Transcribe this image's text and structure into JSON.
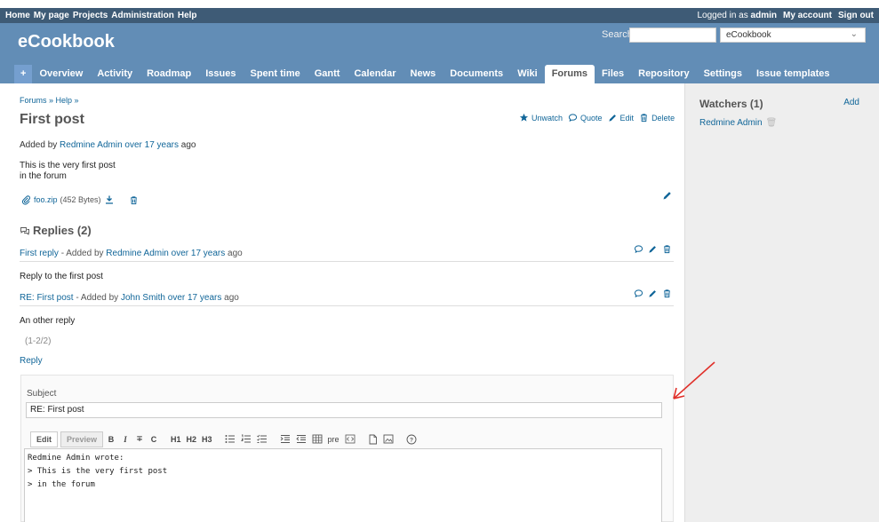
{
  "top_menu": {
    "left_items": [
      "Home",
      "My page",
      "Projects",
      "Administration",
      "Help"
    ],
    "logged_prefix": "Logged in as",
    "logged_user": "admin",
    "right_items": [
      "My account",
      "Sign out"
    ]
  },
  "header": {
    "title": "eCookbook",
    "search_label": "Search:",
    "search_value": "",
    "project_selected": "eCookbook"
  },
  "main_menu": {
    "plus": "+",
    "tabs": [
      "Overview",
      "Activity",
      "Roadmap",
      "Issues",
      "Spent time",
      "Gantt",
      "Calendar",
      "News",
      "Documents",
      "Wiki",
      "Forums",
      "Files",
      "Repository",
      "Settings",
      "Issue templates"
    ],
    "selected": "Forums"
  },
  "breadcrumb": "Forums » Help »",
  "topic": {
    "title": "First post",
    "actions": {
      "unwatch": "Unwatch",
      "quote": "Quote",
      "edit": "Edit",
      "delete": "Delete"
    },
    "added_prefix": "Added by",
    "author": "Redmine Admin",
    "age": "over 17 years",
    "age_suffix": "ago",
    "body_line1": "This is the very first post",
    "body_line2": "in the forum",
    "attachment_name": "foo.zip",
    "attachment_size": "(452 Bytes)"
  },
  "replies": {
    "heading": "Replies (2)",
    "items": [
      {
        "subject": "First reply",
        "sep": "- Added by",
        "author": "Redmine Admin",
        "age": "over 17 years",
        "suffix": "ago",
        "body": "Reply to the first post"
      },
      {
        "subject": "RE: First post",
        "sep": "- Added by",
        "author": "John Smith",
        "age": "over 17 years",
        "suffix": "ago",
        "body": "An other reply"
      }
    ],
    "pagination": "(1-2/2)",
    "reply_link": "Reply"
  },
  "reply_form": {
    "subject_label": "Subject",
    "subject_value": "RE: First post",
    "tab_edit": "Edit",
    "tab_preview": "Preview",
    "toolbar": [
      "B",
      "I",
      "S",
      "C",
      "H1",
      "H2",
      "H3",
      "ul",
      "ol",
      "tl",
      "indent",
      "outdent",
      "table",
      "pre",
      "code",
      "link",
      "image",
      "help"
    ],
    "toolbar_labels": {
      "B": "B",
      "I": "I",
      "S": "∓",
      "C": "C",
      "H1": "H1",
      "H2": "H2",
      "H3": "H3",
      "pre": "pre",
      "help": "?"
    },
    "text_line1": "Redmine Admin wrote:",
    "text_line2": "> This is the very first post",
    "text_line3": "> in the forum"
  },
  "sidebar": {
    "watchers_heading": "Watchers (1)",
    "add_label": "Add",
    "watcher": "Redmine Admin"
  },
  "colors": {
    "top_menu": "#3e5b76",
    "header": "#628db6",
    "link": "#169",
    "annotation_arrow": "#e0302a"
  },
  "icons": {
    "unwatch": "star-icon",
    "quote": "speech-bubble-icon",
    "edit": "pencil-icon",
    "delete": "trash-icon",
    "attachment": "paperclip-icon",
    "download": "download-icon",
    "replies": "chat-bubbles-icon"
  }
}
